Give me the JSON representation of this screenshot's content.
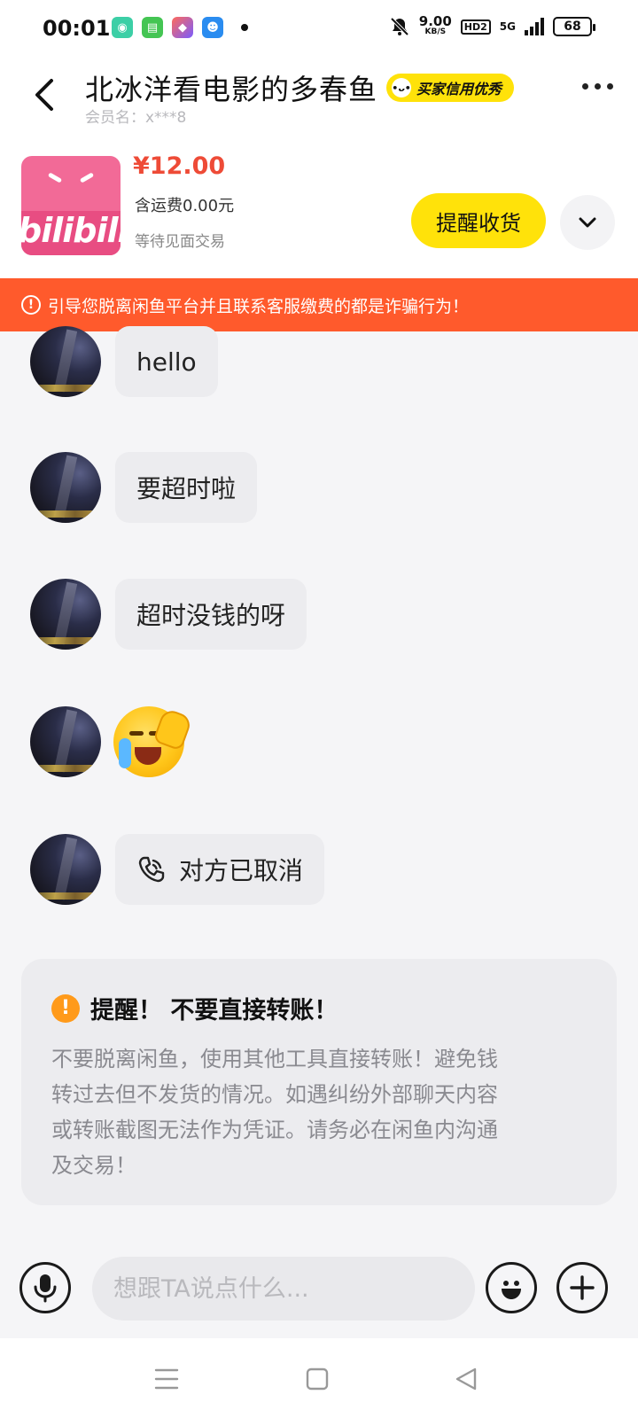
{
  "status_bar": {
    "time": "00:01",
    "net_speed": "9.00",
    "net_unit": "KB/S",
    "hd": "HD2",
    "network": "5G",
    "battery": "68"
  },
  "header": {
    "title": "北冰洋看电影的多春鱼",
    "badge": "买家信用优秀",
    "member": "会员名：x***8"
  },
  "product": {
    "thumb_text": "bilibili",
    "price": "¥12.00",
    "shipping": "含运费0.00元",
    "status": "等待见面交易",
    "remind_button": "提醒收货"
  },
  "banner": {
    "text": "引导您脱离闲鱼平台并且联系客服缴费的都是诈骗行为！"
  },
  "messages": [
    {
      "type": "text",
      "text": "hello"
    },
    {
      "type": "text",
      "text": "要超时啦"
    },
    {
      "type": "text",
      "text": "超时没钱的呀"
    },
    {
      "type": "emoji",
      "emoji": "crying-facepalm"
    },
    {
      "type": "call",
      "text": "对方已取消"
    }
  ],
  "reminder": {
    "title": "提醒！ 不要直接转账！",
    "lines": [
      "不要脱离闲鱼，使用其他工具直接转账！避免钱",
      "转过去但不发货的情况。如遇纠纷外部聊天内容",
      "或转账截图无法作为凭证。请务必在闲鱼内沟通",
      "及交易！"
    ]
  },
  "input": {
    "placeholder": "想跟TA说点什么..."
  },
  "colors": {
    "accent_yellow": "#ffe20a",
    "price_red": "#ee4b37",
    "banner_orange": "#ff5a2c",
    "warning_orange": "#ff9a1a"
  },
  "icons": {
    "back": "chevron-left-icon",
    "more": "more-dots-icon",
    "expand": "chevron-down-icon",
    "voice": "microphone-icon",
    "emoji": "smiley-icon",
    "add": "plus-icon",
    "call": "phone-icon"
  }
}
